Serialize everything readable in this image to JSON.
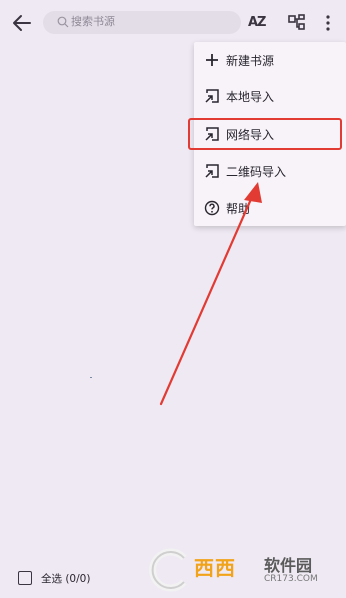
{
  "search": {
    "placeholder": "搜索书源"
  },
  "toolbar": {
    "sort_label": "AZ"
  },
  "menu": {
    "items": [
      {
        "label": "新建书源",
        "icon": "plus-icon"
      },
      {
        "label": "本地导入",
        "icon": "import-icon"
      },
      {
        "label": "网络导入",
        "icon": "import-icon"
      },
      {
        "label": "二维码导入",
        "icon": "import-icon"
      },
      {
        "label": "帮助",
        "icon": "help-icon"
      }
    ]
  },
  "footer": {
    "select_all": "全选 (0/0)"
  },
  "watermark": {
    "brand": "西西",
    "site_name": "软件园",
    "site_url": "CR173.COM"
  },
  "colors": {
    "background": "#efe9f3",
    "highlight": "#e23b33",
    "arrow": "#e23b33"
  }
}
